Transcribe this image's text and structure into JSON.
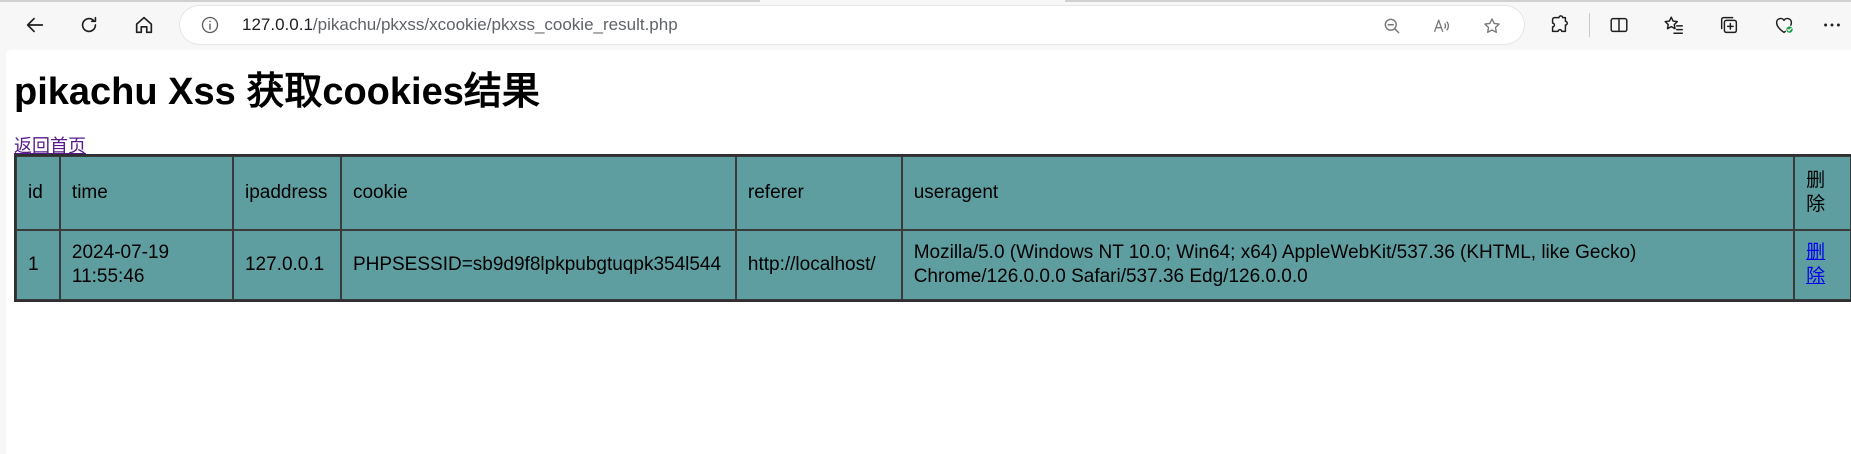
{
  "browser": {
    "url_host": "127.0.0.1",
    "url_path": "/pikachu/pkxss/xcookie/pkxss_cookie_result.php"
  },
  "page": {
    "title": "pikachu Xss 获取cookies结果",
    "home_link": "返回首页",
    "table": {
      "headers": [
        "id",
        "time",
        "ipaddress",
        "cookie",
        "referer",
        "useragent",
        "删除"
      ],
      "rows": [
        {
          "id": "1",
          "time": "2024-07-19 11:55:46",
          "ipaddress": "127.0.0.1",
          "cookie": "PHPSESSID=sb9d9f8lpkpubgtuqpk354l544",
          "referer": "http://localhost/",
          "useragent": "Mozilla/5.0 (Windows NT 10.0; Win64; x64) AppleWebKit/537.36 (KHTML, like Gecko) Chrome/126.0.0.0 Safari/537.36 Edg/126.0.0.0",
          "delete": "删除"
        }
      ]
    }
  },
  "colors": {
    "table_bg": "#5f9ea0",
    "link_visited": "#551a8b",
    "link": "#0000ee"
  }
}
